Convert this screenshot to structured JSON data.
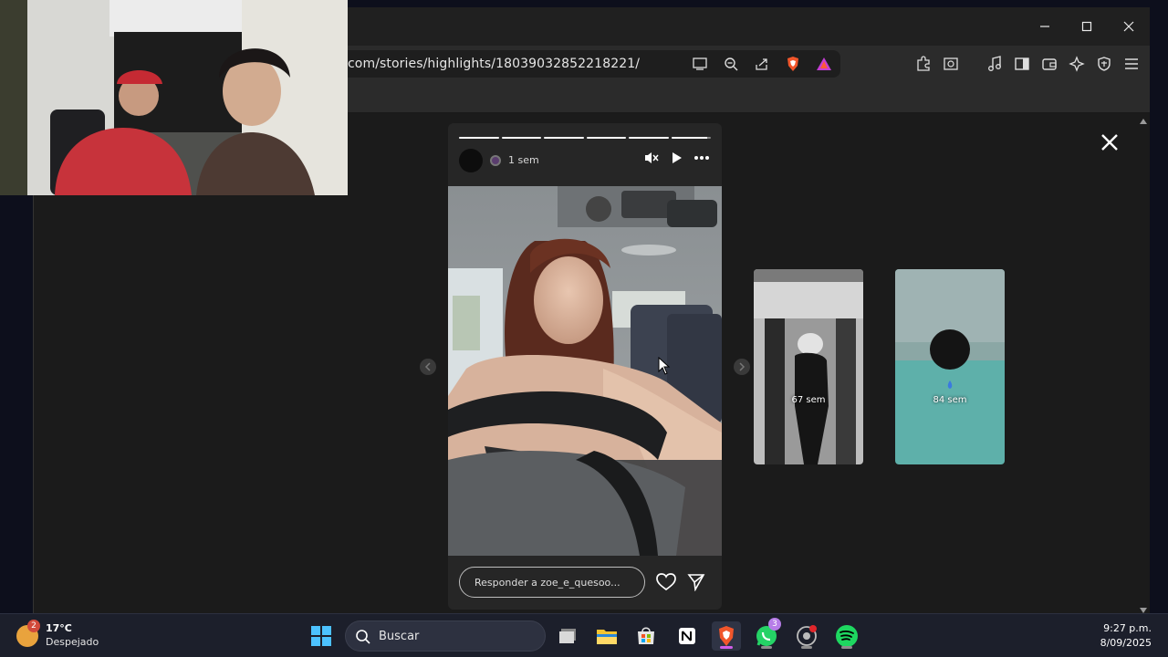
{
  "browser": {
    "url": "com/stories/highlights/18039032852218221/"
  },
  "story": {
    "time": "1 sem",
    "progress": [
      1,
      1,
      1,
      1,
      1,
      0.9
    ],
    "reply_placeholder": "Responder a zoe_e_quesoo..."
  },
  "highlights": [
    {
      "label": "67 sem"
    },
    {
      "label": "84 sem"
    }
  ],
  "taskbar": {
    "weather_badge": "2",
    "temperature": "17°C",
    "weather": "Despejado",
    "search": "Buscar",
    "whatsapp_badge": "3",
    "time": "9:27 p.m.",
    "date": "8/09/2025"
  }
}
